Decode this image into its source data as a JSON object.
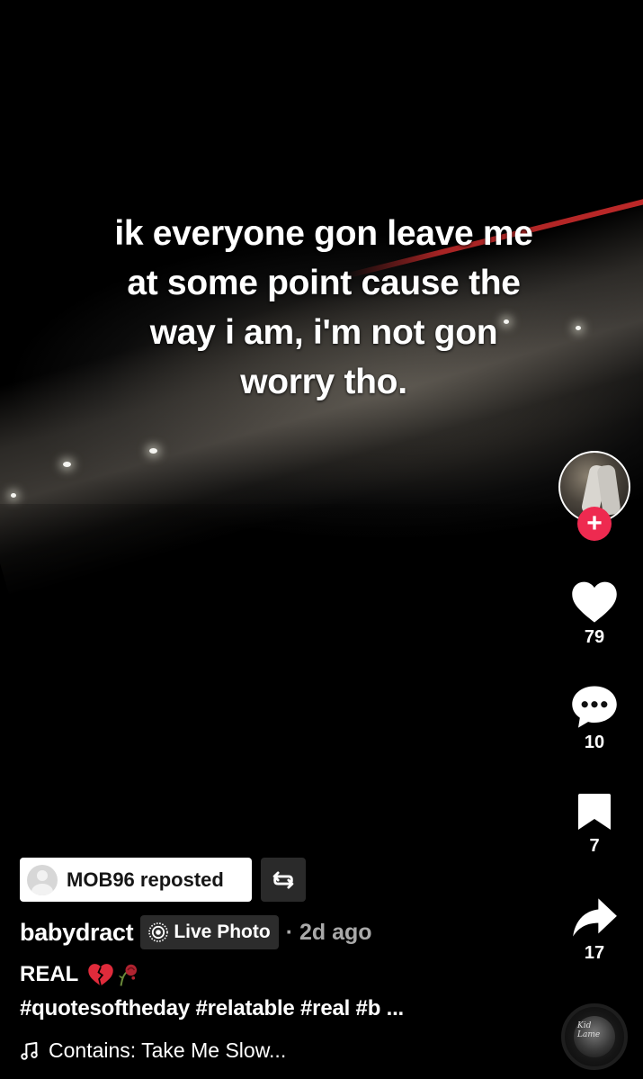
{
  "video": {
    "caption": "ik everyone gon leave me\nat some point cause the\nway i am, i'm not gon\nworry tho."
  },
  "rail": {
    "follow_symbol": "+",
    "like_count": "79",
    "comment_count": "10",
    "bookmark_count": "7",
    "share_count": "17",
    "sound_disc_text": "Kid Lame"
  },
  "repost": {
    "label": "MOB96 reposted"
  },
  "post": {
    "username": "babydract",
    "live_photo_label": "Live Photo",
    "time": "· 2d ago",
    "title": "REAL",
    "hashtags": "#quotesoftheday #relatable #real #b ...",
    "music": "Contains: Take Me Slow..."
  },
  "icons": {
    "like": "heart-icon",
    "comment": "comment-bubble-icon",
    "bookmark": "bookmark-icon",
    "share": "share-arrow-icon",
    "repost": "repost-icon",
    "live": "live-photo-icon",
    "music": "music-note-icon"
  },
  "colors": {
    "follow_accent": "#ee2a50",
    "background": "#000000"
  }
}
